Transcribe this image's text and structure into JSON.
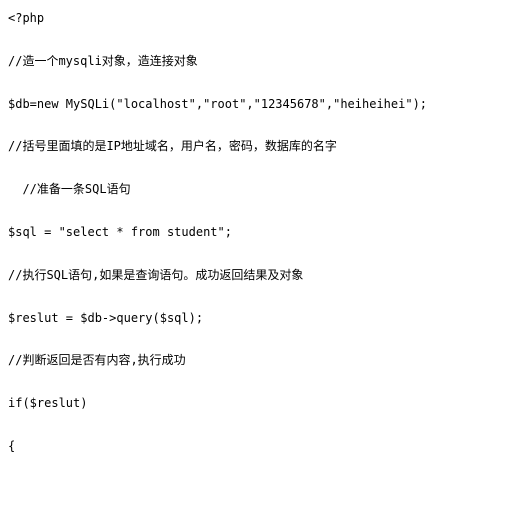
{
  "code": {
    "lines": [
      "<?php",
      "//造一个mysqli对象，造连接对象",
      "$db=new MySQLi(\"localhost\",\"root\",\"12345678\",\"heiheihei\");",
      "//括号里面填的是IP地址域名，用户名，密码，数据库的名字",
      "  //准备一条SQL语句",
      "$sql = \"select * from student\";",
      "//执行SQL语句,如果是查询语句。成功返回结果及对象",
      "$reslut = $db->query($sql);",
      "//判断返回是否有内容,执行成功",
      "if($reslut)",
      "{"
    ]
  }
}
